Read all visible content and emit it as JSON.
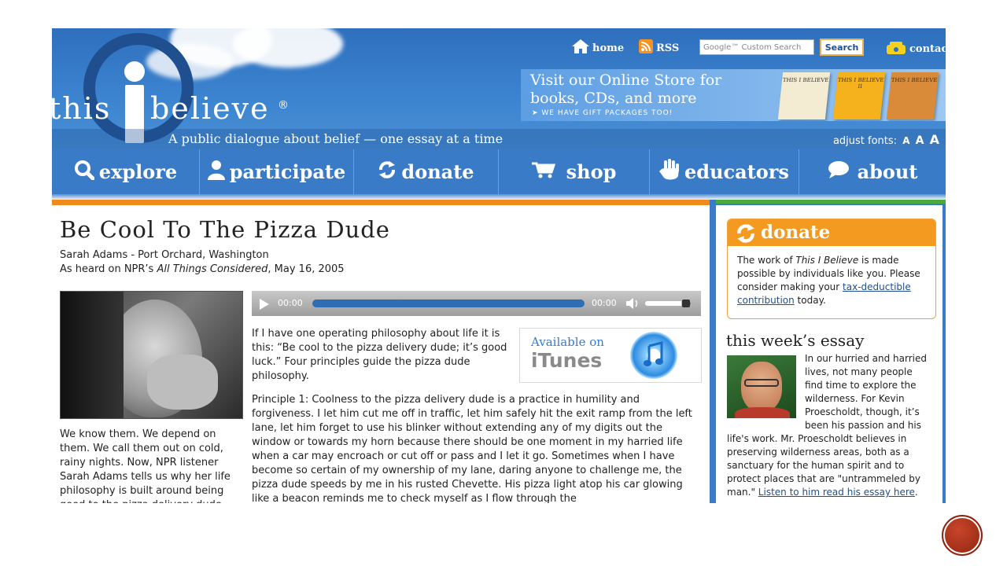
{
  "header": {
    "logo_word_left": "this",
    "logo_word_right": "believe",
    "logo_reg": "®",
    "tagline": "A public dialogue about belief — one essay at a time",
    "adjust_fonts_label": "adjust fonts:",
    "adjust_fonts_sizes": [
      "A",
      "A",
      "A"
    ],
    "toplinks": {
      "home": "home",
      "rss": "RSS",
      "contact": "contact"
    },
    "search_placeholder": "Google™ Custom Search",
    "search_button": "Search",
    "store_banner": {
      "line1": "Visit our Online Store for",
      "line2": "books, CDs, and more",
      "line3": "➤ WE HAVE GIFT PACKAGES TOO!",
      "book_titles": [
        "THIS I BELIEVE",
        "THIS I BELIEVE II",
        "THIS I BELIEVE"
      ]
    }
  },
  "nav": [
    {
      "label": "explore",
      "icon": "search-icon"
    },
    {
      "label": "participate",
      "icon": "person-icon"
    },
    {
      "label": "donate",
      "icon": "recycle-arrows-icon"
    },
    {
      "label": "shop",
      "icon": "cart-icon"
    },
    {
      "label": "educators",
      "icon": "hand-icon"
    },
    {
      "label": "about",
      "icon": "speech-bubble-icon"
    }
  ],
  "article": {
    "title": "Be Cool To The Pizza Dude",
    "author_line": "Sarah Adams - Port Orchard, Washington",
    "heard_prefix": "As heard on NPR’s ",
    "heard_program": "All Things Considered",
    "heard_suffix": ", May 16, 2005",
    "intro": "We know them. We depend on them. We call them out on cold, rainy nights. Now, NPR listener Sarah Adams tells us why her life philosophy is built around being good to the pizza delivery dude.",
    "para1": "If I have one operating philosophy about life it is this: “Be cool to the pizza delivery dude; it’s good luck.” Four principles guide the pizza dude philosophy.",
    "para2": "Principle 1: Coolness to the pizza delivery dude is a practice in humility and forgiveness. I let him cut me off in traffic, let him safely hit the exit ramp from the left lane, let him forget to use his blinker without extending any of my digits out the window or towards my horn because there should be one moment in my harried life when a car may encroach or cut off or pass and I let it go. Sometimes when I have become so certain of my ownership of my lane, daring anyone to challenge me, the pizza dude speeds by me in his rusted Chevette. His pizza light atop his car glowing like a beacon reminds me to check myself as I flow through the"
  },
  "player": {
    "time_elapsed": "00:00",
    "time_total": "00:00",
    "progress": 1.0,
    "volume": 0.8
  },
  "itunes": {
    "available": "Available on",
    "name": "iTunes"
  },
  "sidebar": {
    "donate_title": "donate",
    "donate_text_1": "The work of ",
    "donate_text_em": "This I Believe",
    "donate_text_2": " is made possible by individuals like you. Please consider making your ",
    "donate_link": "tax-deductible contribution",
    "donate_text_3": " today.",
    "essay_heading": "this week’s essay",
    "essay_top": "In our hurried and harried lives, not many people find time to explore the wilderness. For Kevin Proescholdt, though, it’s been his passion and his",
    "essay_bottom": "life's work. Mr. Proescholdt believes in preserving wilderness areas, both as a sanctuary for the human spirit and to protect places that are \"untrammeled by man.\" ",
    "essay_link": "Listen to him read his essay here",
    "essay_after_link": "."
  },
  "colors": {
    "header_blue": "#3a7bc8",
    "orange": "#f08a1a",
    "green": "#4bab3d",
    "link": "#1f4f8e"
  }
}
